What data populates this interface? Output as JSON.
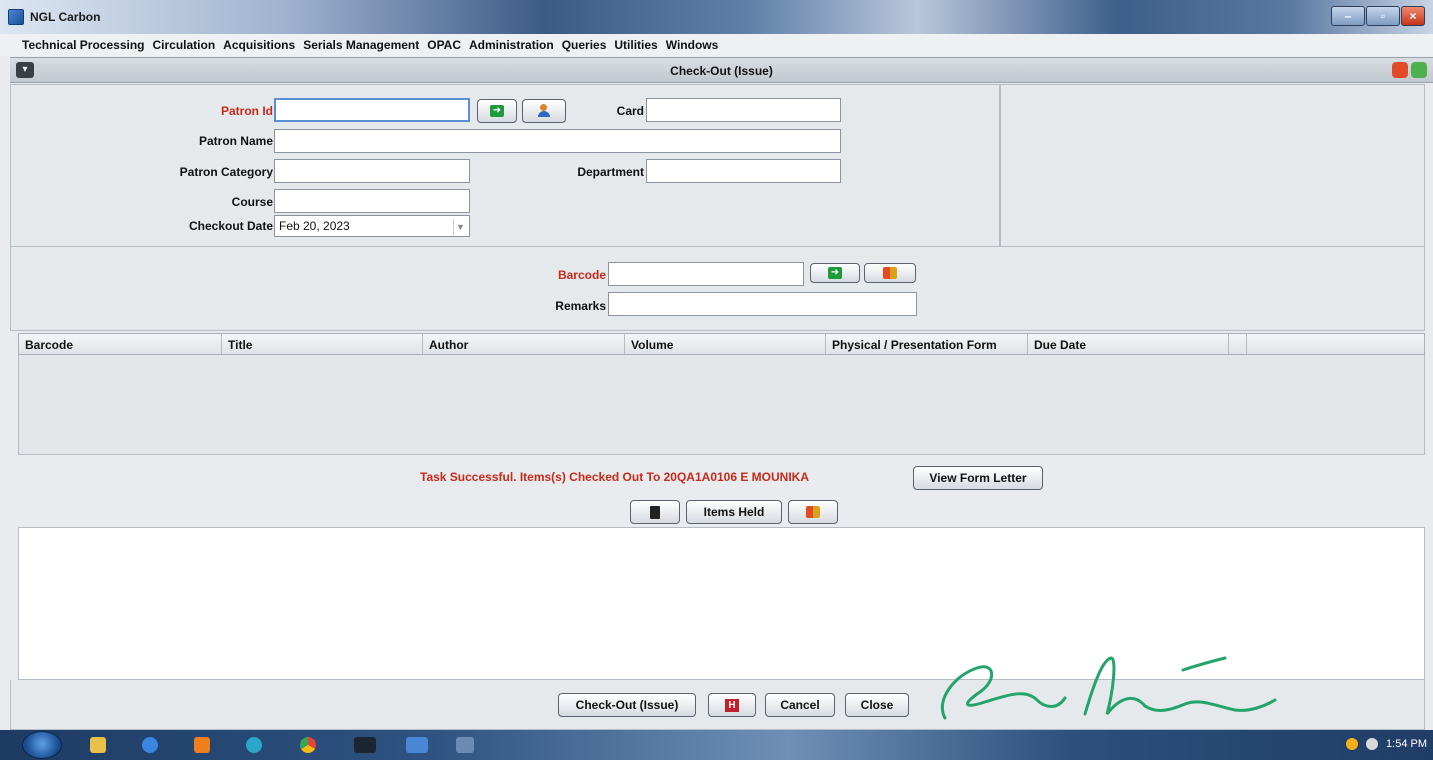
{
  "window": {
    "title": "NGL Carbon"
  },
  "menu": [
    "Technical Processing",
    "Circulation",
    "Acquisitions",
    "Serials Management",
    "OPAC",
    "Administration",
    "Queries",
    "Utilities",
    "Windows"
  ],
  "frame": {
    "title": "Check-Out (Issue)"
  },
  "patron": {
    "patron_id_label": "Patron Id",
    "card_label": "Card",
    "patron_name_label": "Patron Name",
    "patron_category_label": "Patron Category",
    "department_label": "Department",
    "course_label": "Course",
    "checkout_date_label": "Checkout Date",
    "checkout_date_value": "Feb 20, 2023",
    "patron_id_value": "",
    "card_value": "",
    "patron_name_value": "",
    "patron_category_value": "",
    "department_value": "",
    "course_value": ""
  },
  "item": {
    "barcode_label": "Barcode",
    "remarks_label": "Remarks",
    "barcode_value": "",
    "remarks_value": ""
  },
  "table": {
    "columns": [
      "Barcode",
      "Title",
      "Author",
      "Volume",
      "Physical / Presentation Form",
      "Due Date"
    ],
    "rows": []
  },
  "status": {
    "message": "Task Successful. Items(s) Checked Out To 20QA1A0106 E MOUNIKA",
    "view_form_letter": "View Form Letter",
    "items_held": "Items Held"
  },
  "actions": {
    "checkout": "Check-Out (Issue)",
    "cancel": "Cancel",
    "close": "Close"
  },
  "taskbar": {
    "clock": "1:54 PM"
  },
  "colors": {
    "required_label": "#c62a1a",
    "success_message": "#c62a1a",
    "signature_ink": "#23a46b"
  },
  "icons": [
    "app-icon",
    "go-icon",
    "patron-search-icon",
    "stop-icon",
    "delete-icon",
    "hold-icon",
    "windows-start-icon"
  ]
}
